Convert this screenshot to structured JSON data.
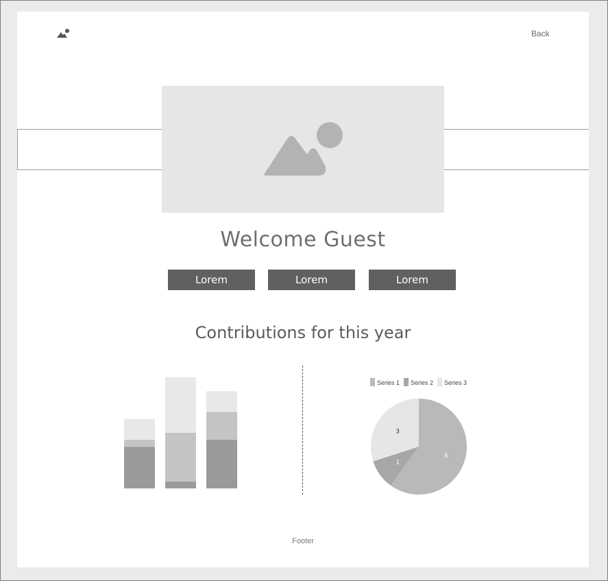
{
  "header": {
    "logo_icon": "image-icon",
    "back_label": "Back"
  },
  "hero": {
    "image_icon": "image-placeholder-icon"
  },
  "welcome": {
    "title": "Welcome Guest"
  },
  "buttons": [
    {
      "label": "Lorem"
    },
    {
      "label": "Lorem"
    },
    {
      "label": "Lorem"
    }
  ],
  "section": {
    "title": "Contributions for this year"
  },
  "chart_data": [
    {
      "type": "bar",
      "stacked": true,
      "categories": [
        "",
        "",
        ""
      ],
      "series": [
        {
          "values": [
            6,
            1,
            7
          ],
          "color": "#9a9a9a"
        },
        {
          "values": [
            1,
            7,
            4
          ],
          "color": "#c4c4c4"
        },
        {
          "values": [
            3,
            8,
            3
          ],
          "color": "#e8e8e8"
        }
      ],
      "ylim": [
        0,
        16
      ],
      "grid": false,
      "axes_visible": false
    },
    {
      "type": "pie",
      "legend": [
        "Series 1",
        "Series 2",
        "Series 3"
      ],
      "legend_placement": "top",
      "colors": [
        "#b9b9b9",
        "#a7a7a7",
        "#e6e6e6"
      ],
      "values": [
        6,
        1,
        3
      ],
      "data_labels": [
        "6",
        "1",
        "3"
      ]
    }
  ],
  "footer": {
    "label": "Footer"
  }
}
